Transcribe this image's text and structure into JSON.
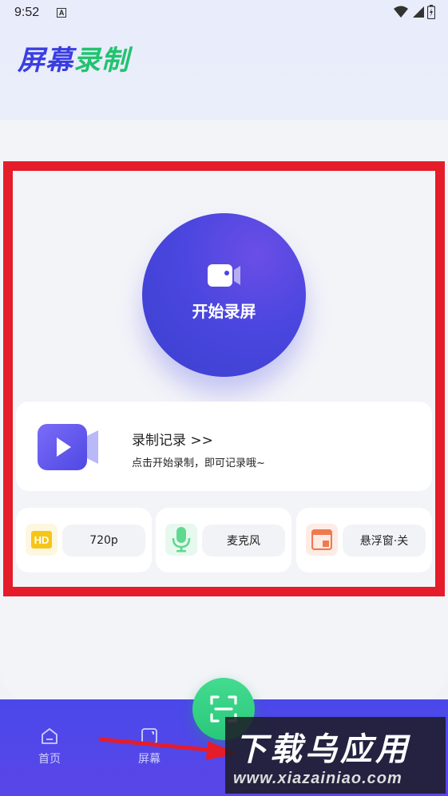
{
  "status_bar": {
    "time": "9:52",
    "notification_badge": "A"
  },
  "app": {
    "title_part1": "屏幕",
    "title_part2": "录制"
  },
  "record_button": {
    "label": "开始录屏",
    "icon": "video-camera-icon"
  },
  "history": {
    "title": "录制记录 >>",
    "subtitle": "点击开始录制，即可记录哦~",
    "icon": "play-video-icon"
  },
  "settings": [
    {
      "icon": "hd-icon",
      "icon_text": "HD",
      "value": "720p"
    },
    {
      "icon": "microphone-icon",
      "value": "麦克风"
    },
    {
      "icon": "floating-window-icon",
      "value": "悬浮窗·关"
    }
  ],
  "bottom_nav": {
    "items": [
      {
        "label": "首页",
        "icon": "home-icon"
      },
      {
        "label": "屏幕",
        "icon": "screen-icon"
      }
    ],
    "fab_icon": "scan-record-icon"
  },
  "watermark": {
    "main": "下载乌应用",
    "sub": "www.xiazainiao.com"
  },
  "colors": {
    "primary": "#4a46df",
    "accent_green": "#2bc87c",
    "highlight_red": "#e51c2a",
    "hd_yellow": "#f5c518",
    "mic_green": "#5ed98f",
    "float_orange": "#f07a4f"
  }
}
